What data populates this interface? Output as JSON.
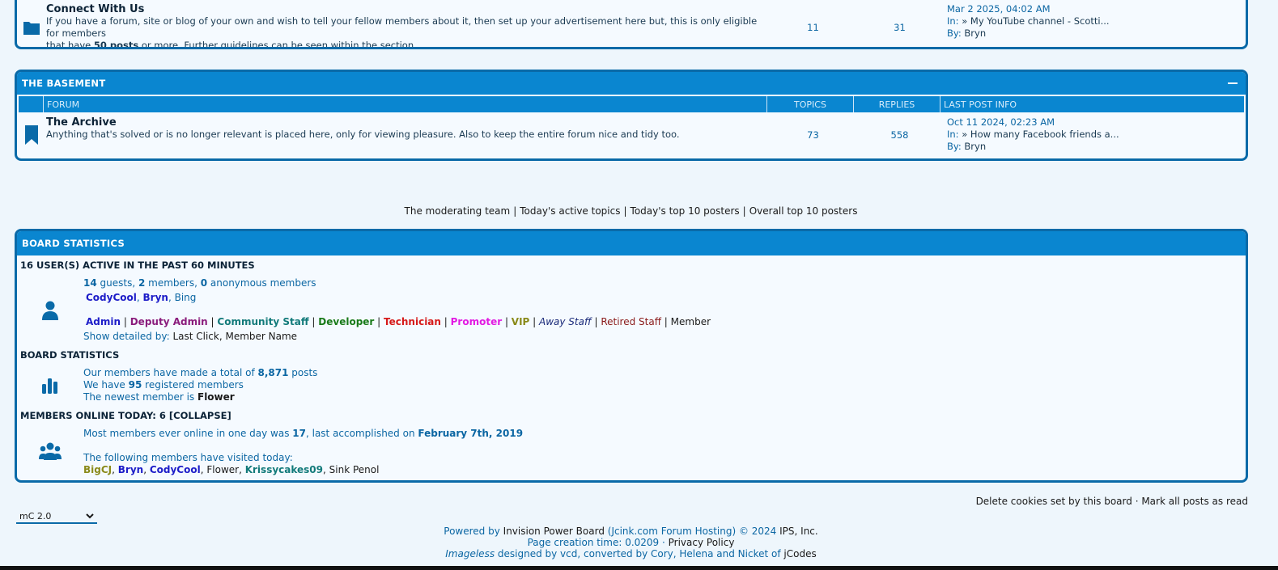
{
  "connect": {
    "title": "Connect With Us",
    "desc_pre": "If you have a forum, site or blog of your own and wish to tell your fellow members about it, then set up your advertisement here but, this is only eligible for members",
    "desc_mid": "that have ",
    "desc_bold": "50 posts",
    "desc_post": " or more. Further guidelines can be seen within the section.",
    "topics": "11",
    "replies": "31",
    "last_date": "Mar 2 2025, 04:02 AM",
    "last_in_label": "In:",
    "last_in_topic": "My YouTube channel - Scotti...",
    "last_by_label": "By:",
    "last_by": "Bryn"
  },
  "basement": {
    "title": "THE BASEMENT",
    "cols": {
      "forum": "FORUM",
      "topics": "TOPICS",
      "replies": "REPLIES",
      "last": "LAST POST INFO"
    },
    "forum": {
      "title": "The Archive",
      "desc": "Anything that's solved or is no longer relevant is placed here, only for viewing pleasure. Also to keep the entire forum nice and tidy too.",
      "topics": "73",
      "replies": "558",
      "last_date": "Oct 11 2024, 02:23 AM",
      "last_in_label": "In:",
      "last_in_topic": "How many Facebook friends a...",
      "last_by_label": "By:",
      "last_by": "Bryn"
    }
  },
  "quicklinks": [
    "The moderating team",
    "Today's active topics",
    "Today's top 10 posters",
    "Overall top 10 posters"
  ],
  "stats": {
    "title": "BOARD STATISTICS",
    "active_head": "16 USER(S) ACTIVE IN THE PAST 60 MINUTES",
    "guests_n": "14",
    "guests_t": " guests, ",
    "members_n": "2",
    "members_t": " members, ",
    "anon_n": "0",
    "anon_t": " anonymous members",
    "active_users": [
      "CodyCool",
      "Bryn",
      "Bing"
    ],
    "groups": [
      {
        "name": "Admin",
        "color": "#1c1cc8"
      },
      {
        "name": "Deputy Admin",
        "color": "#8a1c7c"
      },
      {
        "name": "Community Staff",
        "color": "#127a7a"
      },
      {
        "name": "Developer",
        "color": "#197a19"
      },
      {
        "name": "Technician",
        "color": "#d61a1a"
      },
      {
        "name": "Promoter",
        "color": "#e21ae2"
      },
      {
        "name": "VIP",
        "color": "#8a8a1a"
      },
      {
        "name": "Away Staff",
        "color": "#1a2a7a"
      },
      {
        "name": "Retired Staff",
        "color": "#8a1a1a"
      },
      {
        "name": "Member",
        "color": "#1a1a1a"
      }
    ],
    "detail_label": "Show detailed by: ",
    "detail_last_click": "Last Click",
    "detail_member_name": "Member Name",
    "board_head": "BOARD STATISTICS",
    "posts_pre": "Our members have made a total of ",
    "posts_n": "8,871",
    "posts_post": " posts",
    "reg_pre": "We have ",
    "reg_n": "95",
    "reg_post": " registered members",
    "newest_pre": "The newest member is ",
    "newest": "Flower",
    "online_head": "MEMBERS ONLINE TODAY: 6 [COLLAPSE]",
    "most_pre": "Most members ever online in one day was ",
    "most_n": "17",
    "most_mid": ", last accomplished on ",
    "most_date": "February 7th, 2019",
    "visited_label": "The following members have visited today:",
    "visited": [
      "BigCJ",
      "Bryn",
      "CodyCool",
      "Flower",
      "Krissycakes09",
      "Sink Penol"
    ]
  },
  "footer": {
    "delete_cookies": "Delete cookies set by this board",
    "mark_read": "Mark all posts as read",
    "skin": "mC 2.0",
    "powered_pre": "Powered by ",
    "powered_ipb": "Invision Power Board",
    "powered_host": " (Jcink.com Forum Hosting) © 2024  ",
    "powered_ips": "IPS, Inc.",
    "creation": "Page creation time: 0.0209 · ",
    "privacy": "Privacy Policy",
    "theme_name": "Imageless",
    "designed": " designed by vcd, converted by Cory, Helena and Nicket of ",
    "jcodes": "jCodes"
  },
  "colors": {
    "header_blue": "#0a86d0",
    "border_blue": "#0a6aa8",
    "link_blue": "#0b66a3",
    "bg": "#eef6fc"
  }
}
